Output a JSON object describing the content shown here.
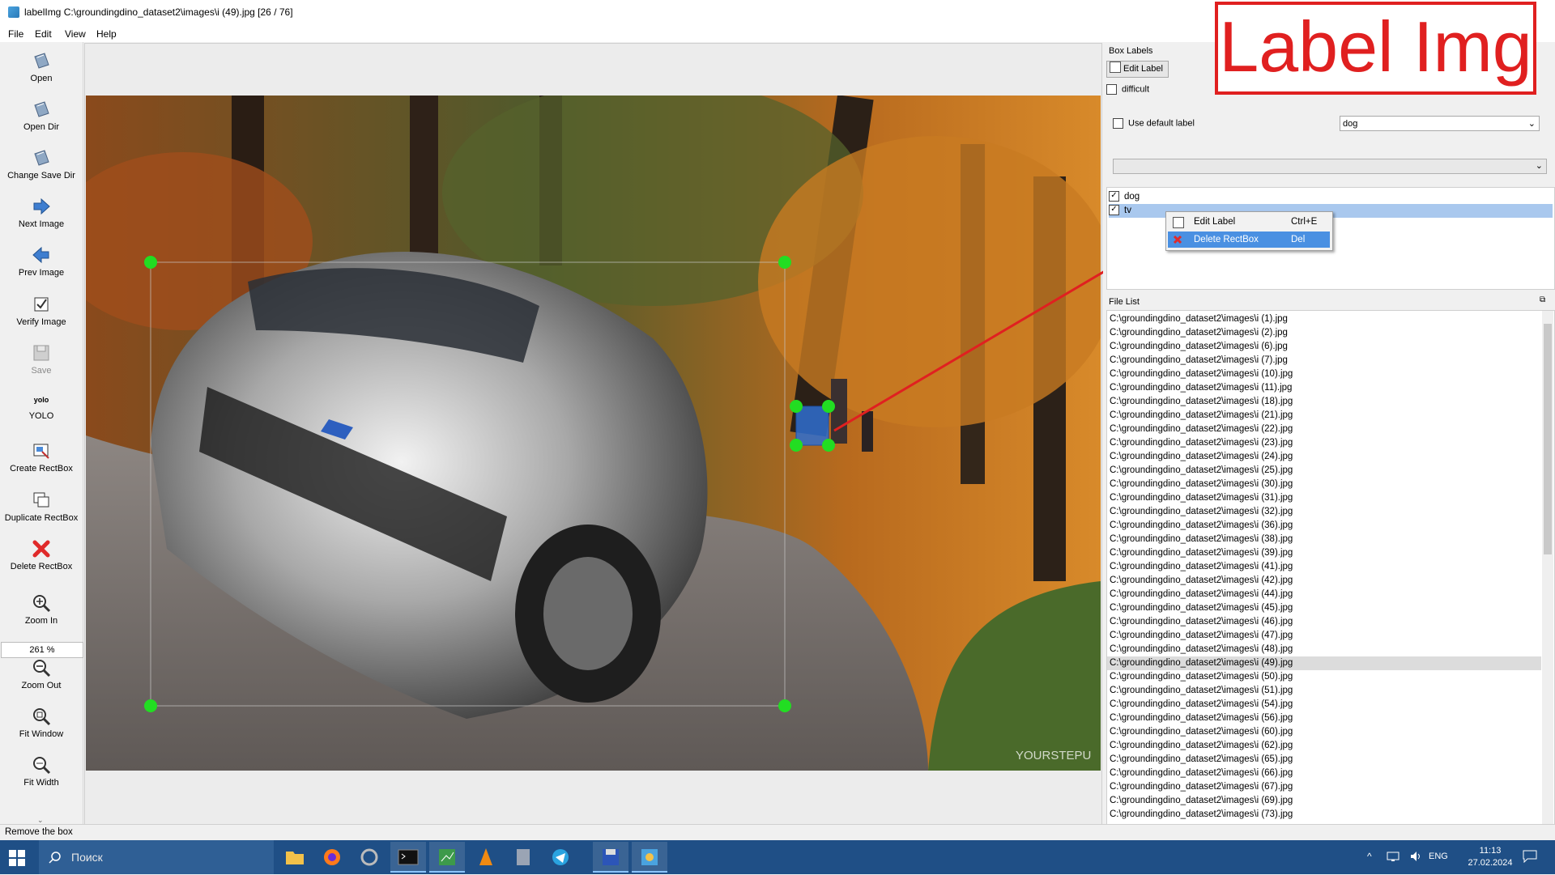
{
  "window": {
    "title": "labelImg C:\\groundingdino_dataset2\\images\\i (49).jpg [26 / 76]"
  },
  "menu": [
    "File",
    "Edit",
    "View",
    "Help"
  ],
  "toolbar": {
    "open": "Open",
    "open_dir": "Open Dir",
    "change_save_dir": "Change Save Dir",
    "next_image": "Next Image",
    "prev_image": "Prev Image",
    "verify_image": "Verify Image",
    "save": "Save",
    "format_icon_text": "yolo",
    "format": "YOLO",
    "create_rectbox": "Create RectBox",
    "duplicate_rectbox": "Duplicate RectBox",
    "delete_rectbox": "Delete RectBox",
    "zoom_in": "Zoom In",
    "zoom_value": "261 %",
    "zoom_out": "Zoom Out",
    "fit_window": "Fit Window",
    "fit_width": "Fit Width"
  },
  "box_labels": {
    "title": "Box Labels",
    "edit_label_button": "Edit Label",
    "difficult": "difficult",
    "use_default_label": "Use default label",
    "default_label_value": "dog",
    "labels": [
      {
        "name": "dog",
        "checked": true,
        "selected": false
      },
      {
        "name": "tv",
        "checked": true,
        "selected": true
      }
    ]
  },
  "context_menu": {
    "items": [
      {
        "label": "Edit Label",
        "shortcut": "Ctrl+E"
      },
      {
        "label": "Delete RectBox",
        "shortcut": "Del"
      }
    ]
  },
  "file_list": {
    "title": "File List",
    "selected_index": 25,
    "files": [
      "C:\\groundingdino_dataset2\\images\\i (1).jpg",
      "C:\\groundingdino_dataset2\\images\\i (2).jpg",
      "C:\\groundingdino_dataset2\\images\\i (6).jpg",
      "C:\\groundingdino_dataset2\\images\\i (7).jpg",
      "C:\\groundingdino_dataset2\\images\\i (10).jpg",
      "C:\\groundingdino_dataset2\\images\\i (11).jpg",
      "C:\\groundingdino_dataset2\\images\\i (18).jpg",
      "C:\\groundingdino_dataset2\\images\\i (21).jpg",
      "C:\\groundingdino_dataset2\\images\\i (22).jpg",
      "C:\\groundingdino_dataset2\\images\\i (23).jpg",
      "C:\\groundingdino_dataset2\\images\\i (24).jpg",
      "C:\\groundingdino_dataset2\\images\\i (25).jpg",
      "C:\\groundingdino_dataset2\\images\\i (30).jpg",
      "C:\\groundingdino_dataset2\\images\\i (31).jpg",
      "C:\\groundingdino_dataset2\\images\\i (32).jpg",
      "C:\\groundingdino_dataset2\\images\\i (36).jpg",
      "C:\\groundingdino_dataset2\\images\\i (38).jpg",
      "C:\\groundingdino_dataset2\\images\\i (39).jpg",
      "C:\\groundingdino_dataset2\\images\\i (41).jpg",
      "C:\\groundingdino_dataset2\\images\\i (42).jpg",
      "C:\\groundingdino_dataset2\\images\\i (44).jpg",
      "C:\\groundingdino_dataset2\\images\\i (45).jpg",
      "C:\\groundingdino_dataset2\\images\\i (46).jpg",
      "C:\\groundingdino_dataset2\\images\\i (47).jpg",
      "C:\\groundingdino_dataset2\\images\\i (48).jpg",
      "C:\\groundingdino_dataset2\\images\\i (49).jpg",
      "C:\\groundingdino_dataset2\\images\\i (50).jpg",
      "C:\\groundingdino_dataset2\\images\\i (51).jpg",
      "C:\\groundingdino_dataset2\\images\\i (54).jpg",
      "C:\\groundingdino_dataset2\\images\\i (56).jpg",
      "C:\\groundingdino_dataset2\\images\\i (60).jpg",
      "C:\\groundingdino_dataset2\\images\\i (62).jpg",
      "C:\\groundingdino_dataset2\\images\\i (65).jpg",
      "C:\\groundingdino_dataset2\\images\\i (66).jpg",
      "C:\\groundingdino_dataset2\\images\\i (67).jpg",
      "C:\\groundingdino_dataset2\\images\\i (69).jpg",
      "C:\\groundingdino_dataset2\\images\\i (73).jpg"
    ]
  },
  "photo": {
    "watermark": "YOURSTEPU"
  },
  "status": {
    "message": "Remove the box"
  },
  "brand": {
    "text": "Label Img"
  },
  "taskbar": {
    "search_placeholder": "Поиск",
    "language": "ENG",
    "time": "11:13",
    "date": "27.02.2024"
  },
  "colors": {
    "handle": "#22dd22",
    "selected_box_fill": "#2f6fd0",
    "annotation_line": "#e02020",
    "taskbar": "#1f4f86"
  }
}
